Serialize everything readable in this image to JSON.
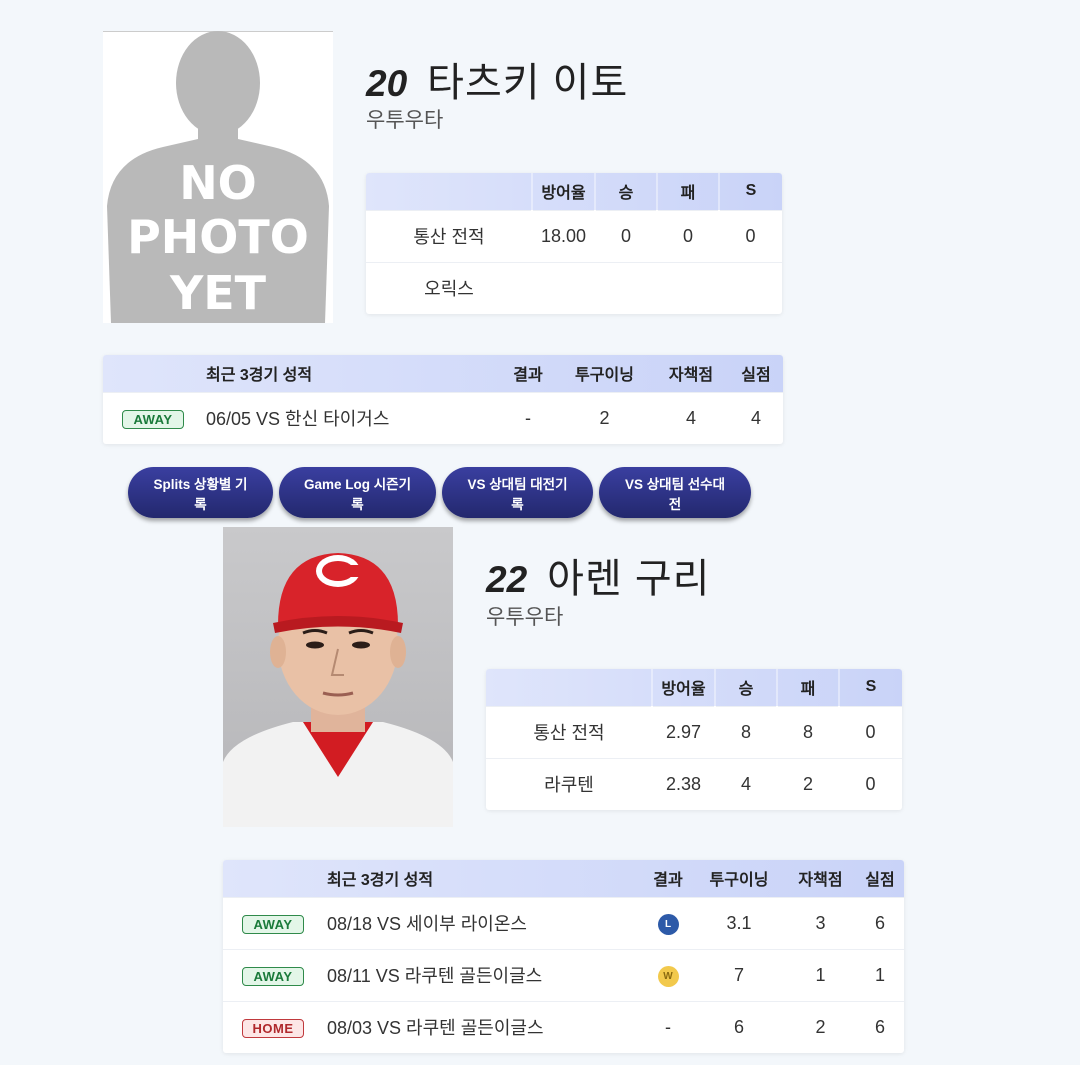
{
  "players": [
    {
      "number": "20",
      "name": "타츠키 이토",
      "position": "우투우타",
      "photo_text": [
        "NO",
        "PHOTO",
        "YET"
      ],
      "stats_headers": [
        "",
        "방어율",
        "승",
        "패",
        "S"
      ],
      "stats_rows": [
        [
          "통산 전적",
          "18.00",
          "0",
          "0",
          "0"
        ],
        [
          "오릭스",
          "",
          "",
          "",
          ""
        ]
      ],
      "recent_headers": [
        "최근 3경기 성적",
        "결과",
        "투구이닝",
        "자책점",
        "실점"
      ],
      "recent_rows": [
        {
          "side": "AWAY",
          "game": "06/05 VS 한신 타이거스",
          "result": "-",
          "ip": "2",
          "er": "4",
          "r": "4"
        }
      ]
    },
    {
      "number": "22",
      "name": "아렌 구리",
      "position": "우투우타",
      "stats_headers": [
        "",
        "방어율",
        "승",
        "패",
        "S"
      ],
      "stats_rows": [
        [
          "통산 전적",
          "2.97",
          "8",
          "8",
          "0"
        ],
        [
          "라쿠텐",
          "2.38",
          "4",
          "2",
          "0"
        ]
      ],
      "recent_headers": [
        "최근 3경기 성적",
        "결과",
        "투구이닝",
        "자책점",
        "실점"
      ],
      "recent_rows": [
        {
          "side": "AWAY",
          "game": "08/18 VS 세이부 라이온스",
          "result": "L",
          "ip": "3.1",
          "er": "3",
          "r": "6"
        },
        {
          "side": "AWAY",
          "game": "08/11 VS 라쿠텐 골든이글스",
          "result": "W",
          "ip": "7",
          "er": "1",
          "r": "1"
        },
        {
          "side": "HOME",
          "game": "08/03 VS 라쿠텐 골든이글스",
          "result": "-",
          "ip": "6",
          "er": "2",
          "r": "6"
        }
      ]
    }
  ],
  "buttons": [
    "Splits 상황별 기록",
    "Game Log 시즌기록",
    "VS 상대팀 대전기록",
    "VS 상대팀 선수대전"
  ],
  "colors": {
    "header_gradient_start": "#dfe5fb",
    "header_gradient_end": "#c9d3f8",
    "button": "#2b3085",
    "away": "#2f8a4a",
    "home": "#c0393d"
  }
}
